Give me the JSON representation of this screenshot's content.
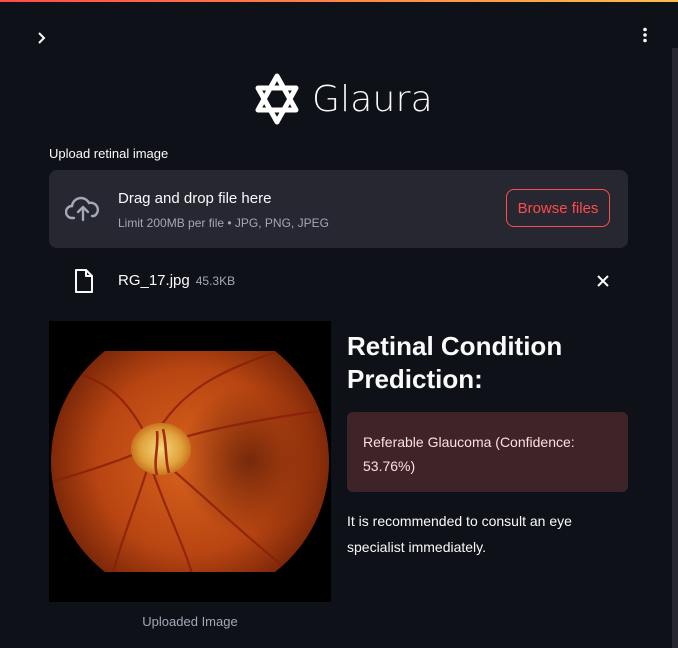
{
  "app": {
    "brand": "Glaura"
  },
  "uploader": {
    "label": "Upload retinal image",
    "drop_title": "Drag and drop file here",
    "drop_subtitle": "Limit 200MB per file • JPG, PNG, JPEG",
    "browse_label": "Browse files",
    "file": {
      "name": "RG_17.jpg",
      "size": "45.3KB"
    }
  },
  "image": {
    "caption": "Uploaded Image"
  },
  "result": {
    "title": "Retinal Condition Prediction:",
    "prediction": "Referable Glaucoma (Confidence: 53.76%)",
    "advice": "It is recommended to consult an eye specialist immediately."
  },
  "colors": {
    "background": "#0e1117",
    "accent": "#ff4b4b",
    "panel": "#262730",
    "alert_bg": "#3e2428"
  },
  "icons": [
    "chevron-right-icon",
    "kebab-menu-icon",
    "glaura-logo-icon",
    "cloud-upload-icon",
    "file-icon",
    "close-icon"
  ]
}
